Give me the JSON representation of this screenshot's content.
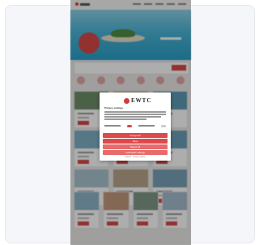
{
  "modal": {
    "brand": "EWTC",
    "title": "Privacy settings",
    "buttons": {
      "accept_all": "Accept all",
      "save": "Save",
      "reject": "Reject all",
      "settings": "Individual settings"
    },
    "links": "Imprint · Privacy policy"
  },
  "colors": {
    "accent": "#d94848",
    "overlay": "rgba(0,0,0,0.32)",
    "card_bg": "#f4f6fa"
  }
}
